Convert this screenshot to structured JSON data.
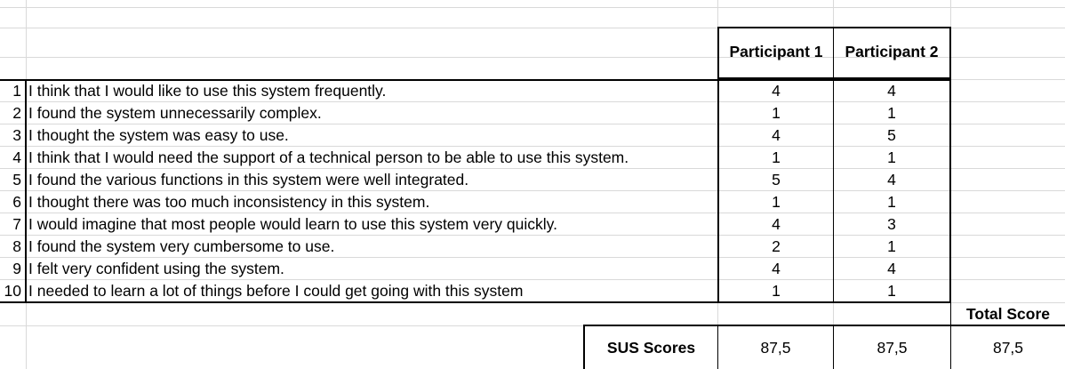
{
  "headers": {
    "participant1": "Participant 1",
    "participant2": "Participant 2",
    "total_score": "Total Score"
  },
  "rows": [
    {
      "n": "1",
      "q": "I think that I would like to use this system frequently.",
      "p1": "4",
      "p2": "4"
    },
    {
      "n": "2",
      "q": "I found the system unnecessarily complex.",
      "p1": "1",
      "p2": "1"
    },
    {
      "n": "3",
      "q": "I thought the system was easy to use.",
      "p1": "4",
      "p2": "5"
    },
    {
      "n": "4",
      "q": "I think that I would need the support of a technical person to be able to use this system.",
      "p1": "1",
      "p2": "1"
    },
    {
      "n": "5",
      "q": "I found the various functions in this system were well integrated.",
      "p1": "5",
      "p2": "4"
    },
    {
      "n": "6",
      "q": "I thought there was too much inconsistency in this system.",
      "p1": "1",
      "p2": "1"
    },
    {
      "n": "7",
      "q": "I would imagine that most people would learn to use this system very quickly.",
      "p1": "4",
      "p2": "3"
    },
    {
      "n": "8",
      "q": "I found the system very cumbersome to use.",
      "p1": "2",
      "p2": "1"
    },
    {
      "n": "9",
      "q": "I felt very confident using the system.",
      "p1": "4",
      "p2": "4"
    },
    {
      "n": "10",
      "q": "I needed to learn a lot of things before I could get going with this system",
      "p1": "1",
      "p2": "1"
    }
  ],
  "sus": {
    "label": "SUS Scores",
    "p1": "87,5",
    "p2": "87,5",
    "total": "87,5"
  }
}
